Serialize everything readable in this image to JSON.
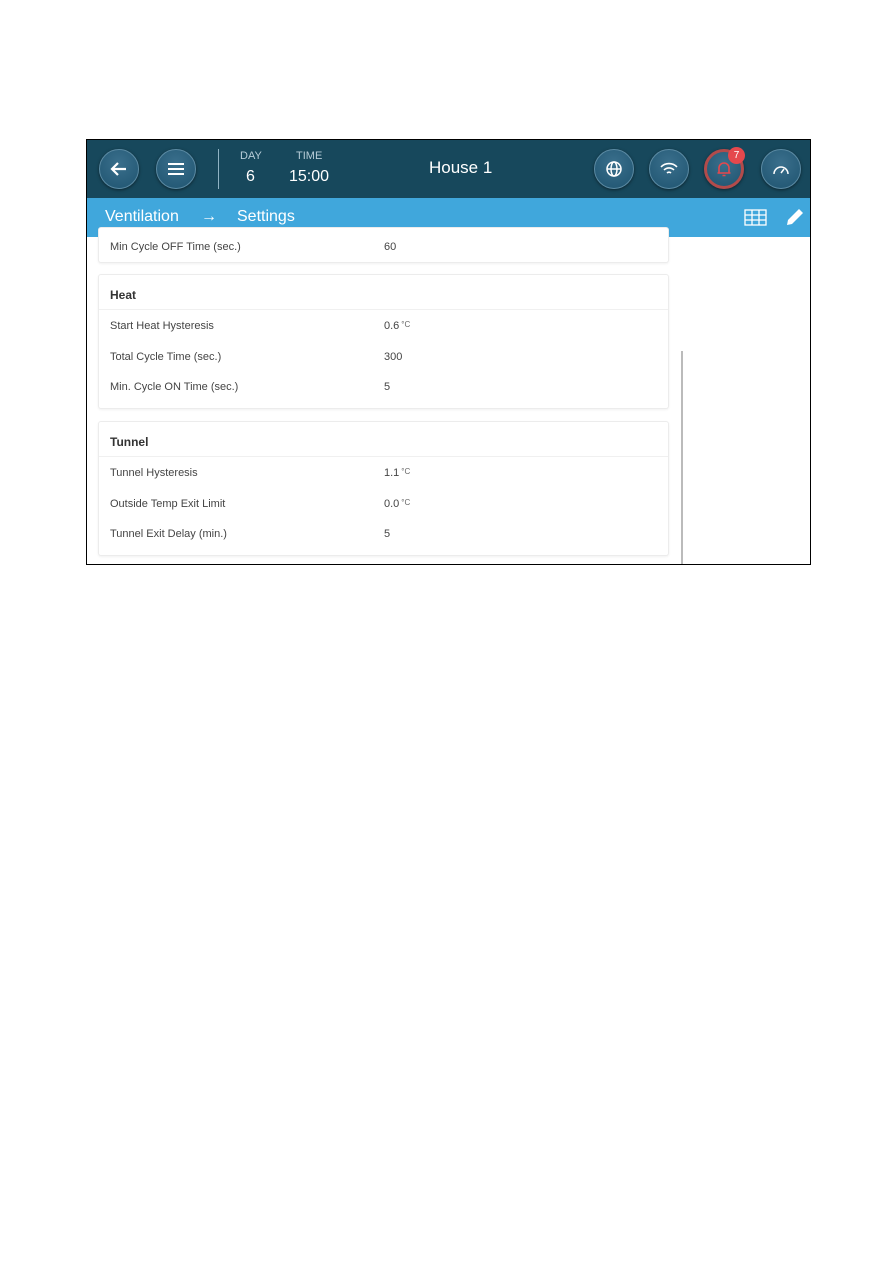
{
  "header": {
    "day_label": "DAY",
    "day": "6",
    "time_label": "TIME",
    "time": "15:00",
    "title": "House 1",
    "alarm_count": "7",
    "alarm_color": "#e5484d"
  },
  "breadcrumb": {
    "section": "Ventilation",
    "arrow": "→",
    "page": "Settings"
  },
  "partial_row": {
    "label": "Min Cycle OFF Time (sec.)",
    "value": "60"
  },
  "heat": {
    "title": "Heat",
    "rows": [
      {
        "label": "Start Heat Hysteresis",
        "value": "0.6",
        "unit": "°C"
      },
      {
        "label": "Total Cycle Time (sec.)",
        "value": "300",
        "unit": ""
      },
      {
        "label": "Min. Cycle ON Time (sec.)",
        "value": "5",
        "unit": ""
      }
    ]
  },
  "tunnel": {
    "title": "Tunnel",
    "rows": [
      {
        "label": "Tunnel Hysteresis",
        "value": "1.1",
        "unit": "°C"
      },
      {
        "label": "Outside Temp Exit Limit",
        "value": "0.0",
        "unit": "°C"
      },
      {
        "label": "Tunnel Exit Delay (min.)",
        "value": "5",
        "unit": ""
      }
    ]
  }
}
